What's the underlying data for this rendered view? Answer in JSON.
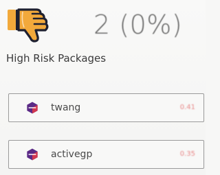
{
  "header": {
    "icon": "thumbs-down-icon",
    "count_text": "2 (0%)"
  },
  "section": {
    "title": "High Risk Packages"
  },
  "packages": [
    {
      "name": "twang",
      "score": "0.41",
      "logo": "package-logo-icon"
    },
    {
      "name": "activegp",
      "score": "0.35",
      "logo": "package-logo-icon"
    }
  ],
  "colors": {
    "icon_orange": "#f2a93b",
    "icon_dark": "#1e2030",
    "score_red": "#e88787",
    "logo_purple": "#5b2a86",
    "logo_red": "#e63946"
  }
}
